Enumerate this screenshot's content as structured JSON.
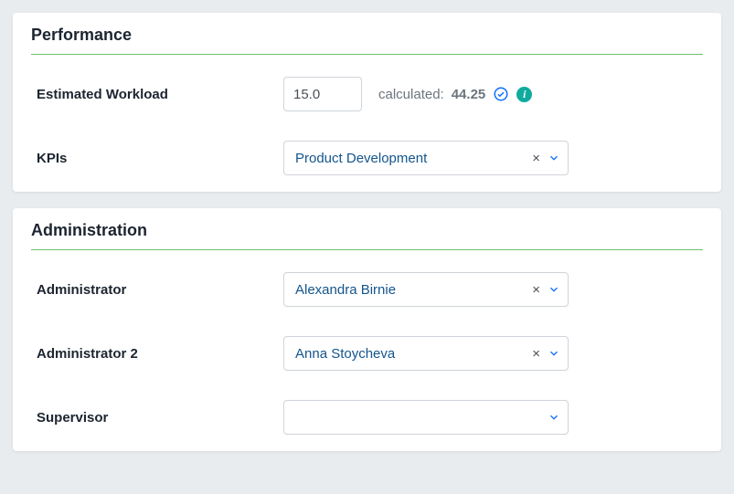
{
  "performance": {
    "title": "Performance",
    "workload_label": "Estimated Workload",
    "workload_value": "15.0",
    "calculated_label": "calculated:",
    "calculated_value": "44.25",
    "kpis_label": "KPIs",
    "kpis_value": "Product Development"
  },
  "administration": {
    "title": "Administration",
    "admin1_label": "Administrator",
    "admin1_value": "Alexandra Birnie",
    "admin2_label": "Administrator 2",
    "admin2_value": "Anna Stoycheva",
    "supervisor_label": "Supervisor",
    "supervisor_value": ""
  }
}
